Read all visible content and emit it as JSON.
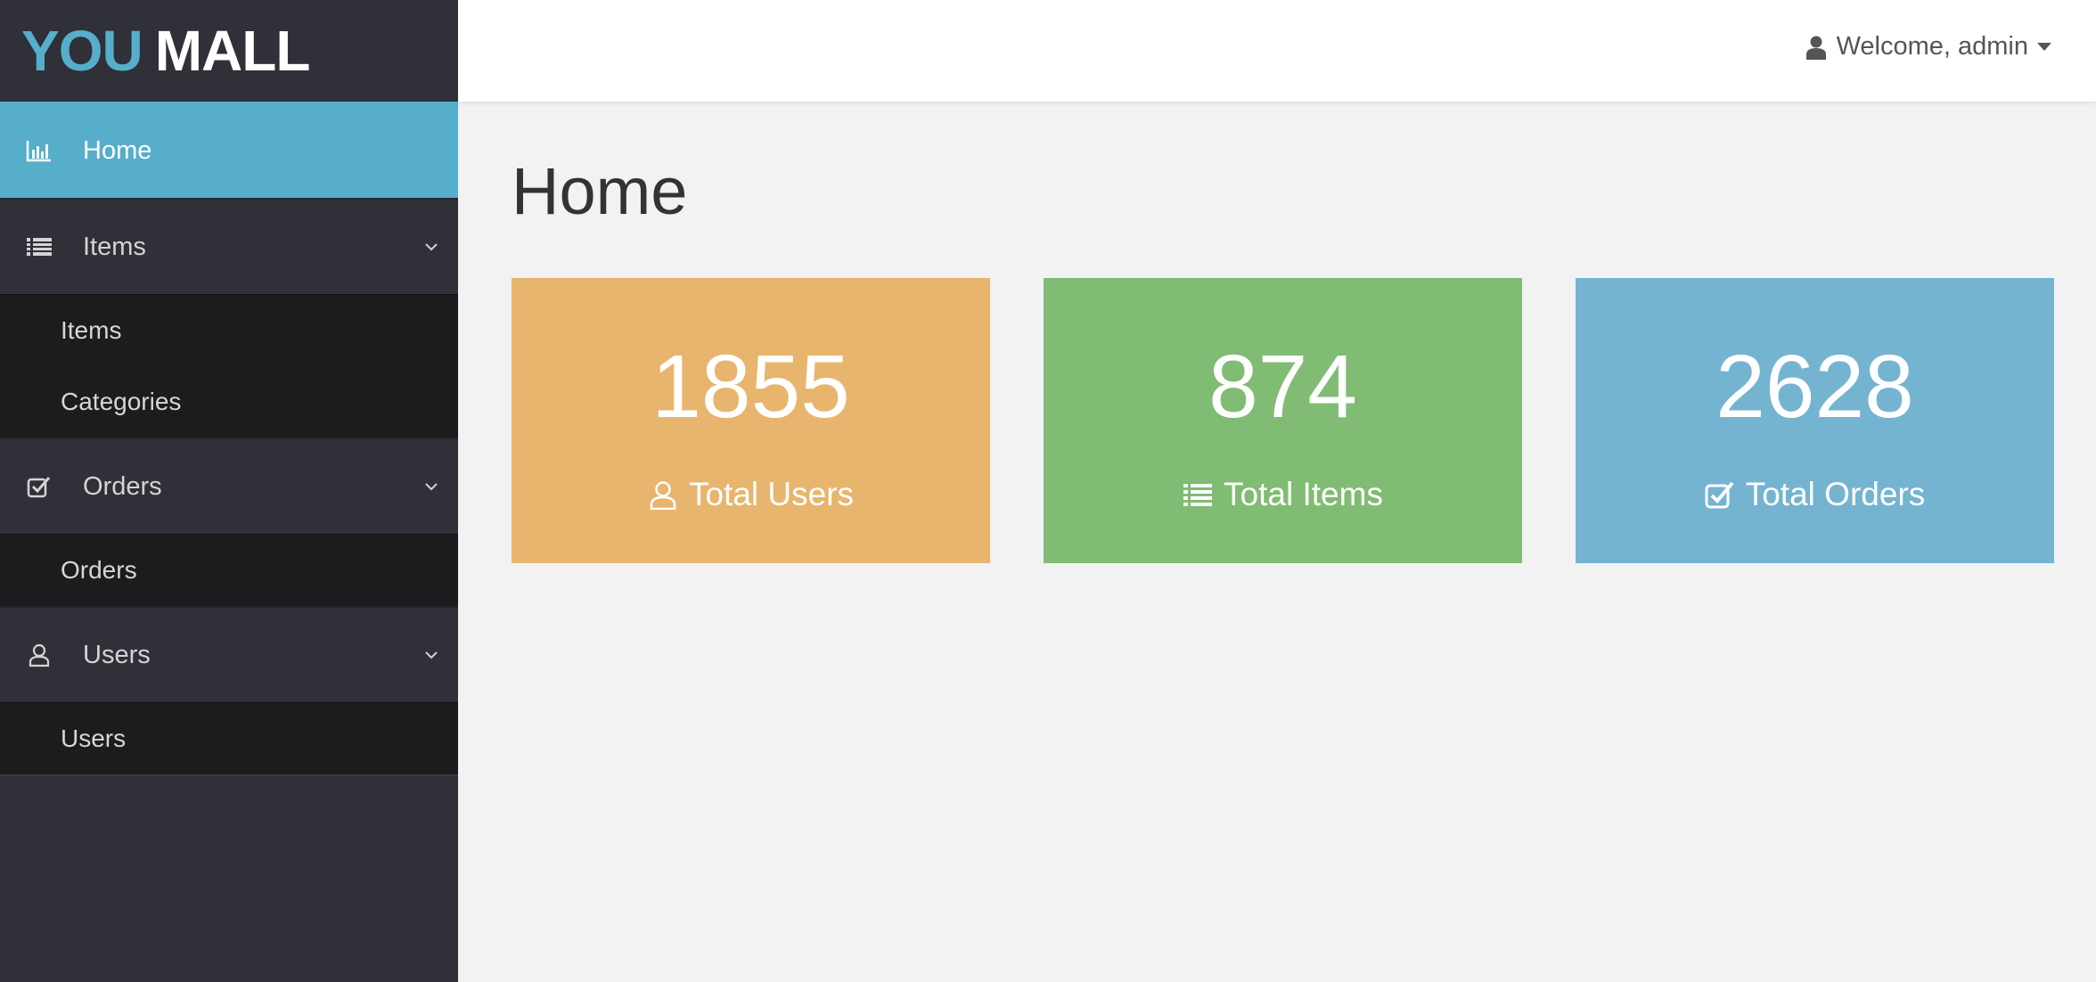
{
  "logo": {
    "part1": "YOU",
    "part2": "MALL"
  },
  "sidebar": {
    "home": {
      "label": "Home",
      "icon": "bar-chart-icon"
    },
    "items_group": {
      "label": "Items",
      "icon": "list-icon",
      "children": [
        "Items",
        "Categories"
      ]
    },
    "orders_group": {
      "label": "Orders",
      "icon": "checkbox-icon",
      "children": [
        "Orders"
      ]
    },
    "users_group": {
      "label": "Users",
      "icon": "user-icon",
      "children": [
        "Users"
      ]
    }
  },
  "header": {
    "welcome": "Welcome, admin"
  },
  "main": {
    "title": "Home",
    "cards": [
      {
        "value": "1855",
        "label": "Total Users",
        "icon": "user-icon",
        "color": "#e8b56e"
      },
      {
        "value": "874",
        "label": "Total Items",
        "icon": "list-icon",
        "color": "#80bc73"
      },
      {
        "value": "2628",
        "label": "Total Orders",
        "icon": "checkbox-icon",
        "color": "#74b4d0"
      }
    ]
  },
  "colors": {
    "accent": "#56aecb",
    "sidebar_bg": "#2f3038",
    "submenu_bg": "#1c1c1f"
  }
}
